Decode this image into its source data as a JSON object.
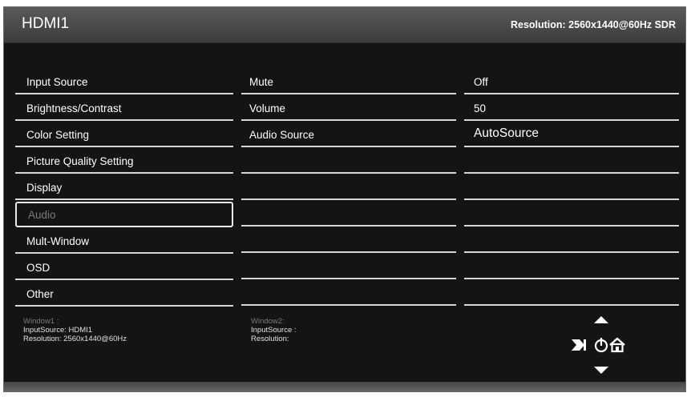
{
  "header": {
    "title": "HDMI1",
    "resolution": "Resolution: 2560x1440@60Hz SDR"
  },
  "menu": {
    "items": [
      {
        "label": "Input Source"
      },
      {
        "label": "Brightness/Contrast"
      },
      {
        "label": "Color Setting"
      },
      {
        "label": "Picture Quality Setting"
      },
      {
        "label": "Display"
      },
      {
        "label": "Audio",
        "selected": true
      },
      {
        "label": "Mult-Window"
      },
      {
        "label": "OSD"
      },
      {
        "label": "Other"
      }
    ]
  },
  "submenu": {
    "items": [
      {
        "label": "Mute"
      },
      {
        "label": "Volume"
      },
      {
        "label": "Audio Source"
      }
    ]
  },
  "values": {
    "items": [
      {
        "value": "Off"
      },
      {
        "value": "50"
      },
      {
        "value": "AutoSource"
      }
    ]
  },
  "window1": {
    "title": "Window1 :",
    "input_source": "InputSource: HDMI1",
    "resolution": "Resolution: 2560x1440@60Hz"
  },
  "window2": {
    "title": "Window2:",
    "input_source": "InputSource :",
    "resolution": "Resolution:"
  },
  "nav": {
    "icons": [
      "up-arrow-icon",
      "exit-icon",
      "power-icon",
      "home-icon",
      "down-arrow-icon"
    ]
  }
}
